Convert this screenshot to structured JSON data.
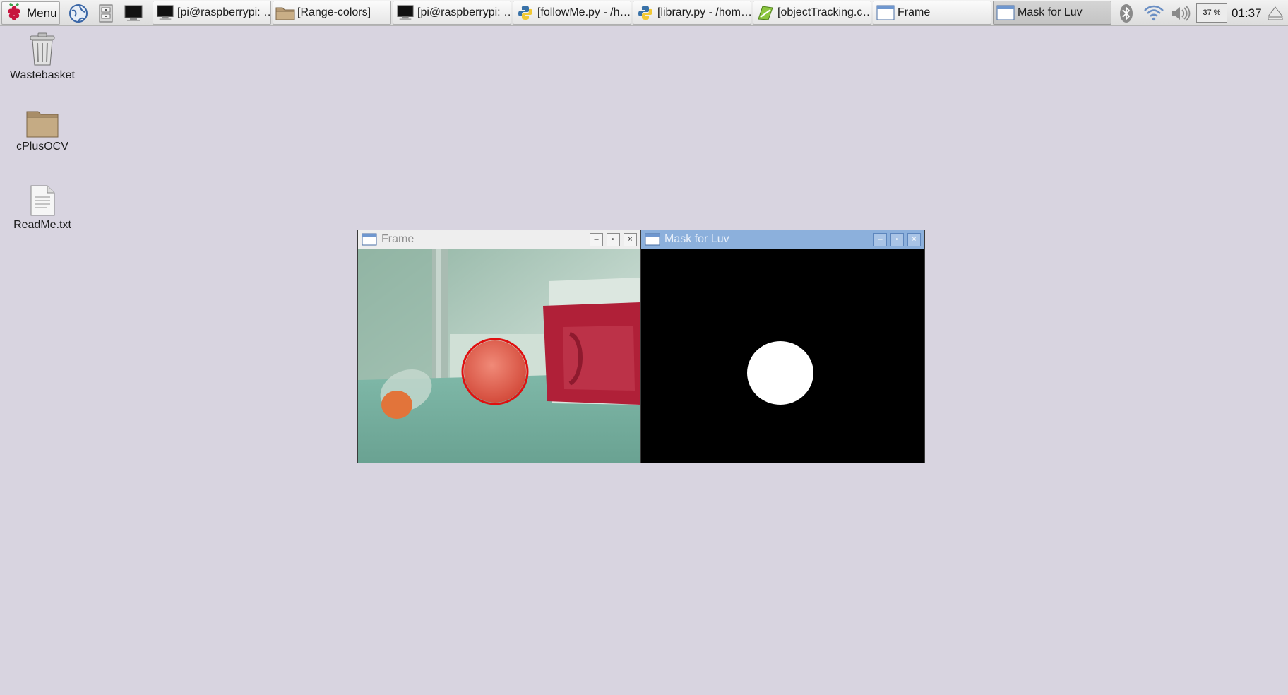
{
  "taskbar": {
    "menu_label": "Menu",
    "launchers": [
      "web-browser",
      "file-manager",
      "terminal"
    ],
    "tasks": [
      {
        "label": "[pi@raspberrypi: …",
        "icon": "terminal-icon",
        "active": false
      },
      {
        "label": "[Range-colors]",
        "icon": "folder-icon",
        "active": false
      },
      {
        "label": "[pi@raspberrypi: …",
        "icon": "terminal-icon",
        "active": false
      },
      {
        "label": "[followMe.py - /h…",
        "icon": "python-icon",
        "active": false
      },
      {
        "label": "[library.py - /hom…",
        "icon": "python-icon",
        "active": false
      },
      {
        "label": "[objectTracking.c…",
        "icon": "text-editor-icon",
        "active": false
      },
      {
        "label": "Frame",
        "icon": "window-icon",
        "active": false
      },
      {
        "label": "Mask for Luv",
        "icon": "window-icon",
        "active": true
      }
    ],
    "tray": {
      "cpu_percent": "37 %",
      "clock": "01:37"
    }
  },
  "desktop": {
    "icons": [
      {
        "label": "Wastebasket",
        "icon": "trash-icon"
      },
      {
        "label": "cPlusOCV",
        "icon": "folder-icon"
      },
      {
        "label": "ReadMe.txt",
        "icon": "text-file-icon"
      }
    ]
  },
  "windows": {
    "frame": {
      "title": "Frame",
      "active": false
    },
    "mask": {
      "title": "Mask for Luv",
      "active": true
    }
  },
  "colors": {
    "desktop_bg": "#d8d4e0",
    "active_titlebar": "#8cb0dc",
    "tracking_circle": "#e01010",
    "ball": "#e4604e",
    "cooler": "#b02038"
  }
}
